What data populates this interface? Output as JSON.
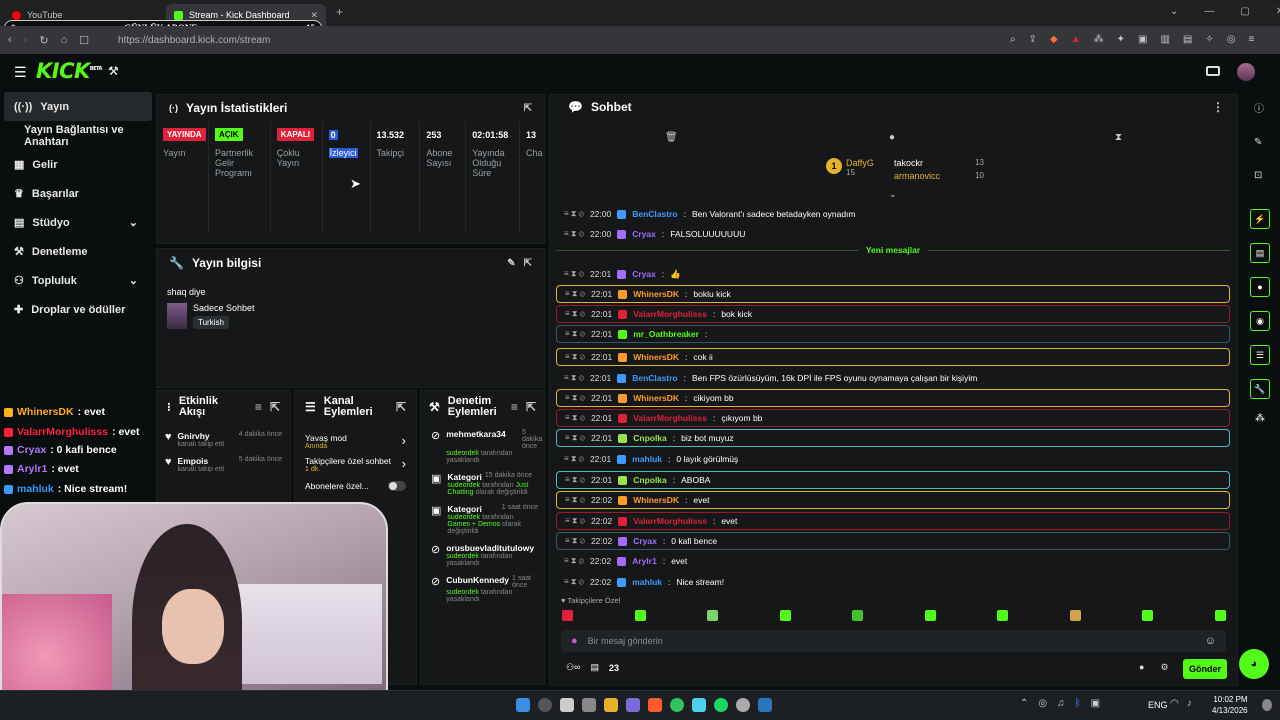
{
  "browser": {
    "tabs": [
      {
        "label": "YouTube"
      },
      {
        "label": "Stream - Kick Dashboard"
      }
    ],
    "overlay_title": "GÜNLÜK ABONE",
    "overlay_left": "0",
    "overlay_right": "15",
    "url": "https://dashboard.kick.com/stream"
  },
  "app": {
    "logo": "KICK",
    "logo_badge": "BETA"
  },
  "sidebar": {
    "items": [
      {
        "label": "Yayın",
        "icon": "broadcast-icon"
      },
      {
        "label": "Yayın Bağlantısı ve Anahtarı",
        "icon": "key-icon"
      },
      {
        "label": "Gelir",
        "icon": "revenue-icon"
      },
      {
        "label": "Başarılar",
        "icon": "trophy-icon"
      },
      {
        "label": "Stüdyo",
        "icon": "studio-icon"
      },
      {
        "label": "Denetleme",
        "icon": "hammer-icon"
      },
      {
        "label": "Topluluk",
        "icon": "community-icon"
      },
      {
        "label": "Droplar ve ödüller",
        "icon": "gift-icon"
      }
    ]
  },
  "stats": {
    "title": "Yayın İstatistikleri",
    "cols": [
      {
        "value": "YAYINDA",
        "label": "Yayın"
      },
      {
        "value": "AÇIK",
        "label": "Partnerlik Gelir Programı"
      },
      {
        "value": "KAPALI",
        "label": "Çoklu Yayın"
      },
      {
        "value": "0",
        "label": "İzleyici"
      },
      {
        "value": "13.532",
        "label": "Takipçi"
      },
      {
        "value": "253",
        "label": "Abone Sayısı"
      },
      {
        "value": "02:01:58",
        "label": "Yayında Olduğu Süre"
      },
      {
        "value": "13",
        "label": "Cha In A"
      }
    ]
  },
  "info": {
    "title": "Yayın bilgisi",
    "stream_title": "shaq diye",
    "category": "Sadece Sohbet",
    "tag": "Turkish"
  },
  "activity": {
    "title": "Etkinlik Akışı",
    "items": [
      {
        "name": "Gnirvhy",
        "time": "4 dakika önce",
        "desc": "kanalı takip etti"
      },
      {
        "name": "Empois",
        "time": "5 dakika önce",
        "desc": "kanalı takip etti"
      }
    ]
  },
  "channel": {
    "title": "Kanal Eylemleri",
    "items": [
      {
        "label": "Yavaş mod",
        "sub": "Anında"
      },
      {
        "label": "Takipçilere özel sohbet",
        "sub": "1 dk."
      },
      {
        "label": "Abonelere özel..."
      }
    ]
  },
  "moderation": {
    "title": "Denetim Eylemleri",
    "items": [
      {
        "name": "mehmetkara34",
        "time": "5 dakika önce",
        "l1": "sudeordek",
        "l2": "tarafından",
        "l3": "yasaklandı"
      },
      {
        "name": "Kategori",
        "time": "15 dakika önce",
        "l1": "sudeordek",
        "l2": "tarafından",
        "l3": "Just Chatting",
        "l4": "olarak değiştirildi"
      },
      {
        "name": "Kategori",
        "time": "1 saat önce",
        "l1": "sudeordek",
        "l2": "tarafından",
        "l3": "Games + Demos",
        "l4": "olarak değiştirildi"
      },
      {
        "name": "orusbuevladitutulowy",
        "l1": "sudeordek",
        "l2": "tarafından yasaklandı"
      },
      {
        "name": "CubunKennedy",
        "time": "1 saat önce",
        "l1": "sudeordek",
        "l2": "tarafından yasaklandı"
      }
    ]
  },
  "chat": {
    "title": "Sohbet",
    "leaderboard": [
      {
        "rank": "1",
        "name": "DaffyG",
        "count": "15"
      },
      {
        "name": "takockr",
        "count": "13"
      },
      {
        "name": "armanovicc",
        "count": "10"
      }
    ],
    "new_messages": "Yeni mesajlar",
    "messages": [
      {
        "time": "22:00",
        "user": "BenClastro",
        "ucolor": "#3b9cff",
        "text": "Ben Valorant'ı sadece betadayken oynadım",
        "hl": ""
      },
      {
        "time": "22:00",
        "user": "Cryax",
        "ucolor": "#a46bff",
        "text": "FALSOLUUUUUUU",
        "hl": ""
      },
      {
        "time": "22:01",
        "user": "Cryax",
        "ucolor": "#a46bff",
        "text": "👍",
        "hl": ""
      },
      {
        "time": "22:01",
        "user": "WhinersDK",
        "ucolor": "#ff9b2b",
        "text": "boklu kick",
        "hl": "#e4b32a"
      },
      {
        "time": "22:01",
        "user": "ValarrMorghulisss",
        "ucolor": "#e0213c",
        "text": "bok kick",
        "hl": "#9a1a2a"
      },
      {
        "time": "22:01",
        "user": "mr_Oathbreaker",
        "ucolor": "#53fc18",
        "text": "",
        "hl": "#2f5c68"
      },
      {
        "time": "22:01",
        "user": "WhinersDK",
        "ucolor": "#ff9b2b",
        "text": "cok ii",
        "hl": "#e4b32a"
      },
      {
        "time": "22:01",
        "user": "BenClastro",
        "ucolor": "#3b9cff",
        "text": "Ben FPS özürlüsüyüm, 16k DPİ ile FPS oyunu oynamaya çalışan bir kişiyim",
        "hl": ""
      },
      {
        "time": "22:01",
        "user": "WhinersDK",
        "ucolor": "#ff9b2b",
        "text": "cikiyom bb",
        "hl": "#e4b32a"
      },
      {
        "time": "22:01",
        "user": "ValarrMorghulisss",
        "ucolor": "#e0213c",
        "text": "çıkıyom bb",
        "hl": "#9a1a2a"
      },
      {
        "time": "22:01",
        "user": "Cnpolka",
        "ucolor": "#9be34a",
        "text": "biz bot muyuz",
        "hl": "#3fc0c0"
      },
      {
        "time": "22:01",
        "user": "mahluk",
        "ucolor": "#3b9cff",
        "text": "0 layık görülmüş",
        "hl": ""
      },
      {
        "time": "22:01",
        "user": "Cnpolka",
        "ucolor": "#9be34a",
        "text": "ABOBA",
        "hl": "#3fc0c0"
      },
      {
        "time": "22:02",
        "user": "WhinersDK",
        "ucolor": "#ff9b2b",
        "text": "evet",
        "hl": "#e4b32a"
      },
      {
        "time": "22:02",
        "user": "ValarrMorghulisss",
        "ucolor": "#e0213c",
        "text": "evet",
        "hl": "#9a1a2a"
      },
      {
        "time": "22:02",
        "user": "Cryax",
        "ucolor": "#a46bff",
        "text": "0 kafi bence",
        "hl": "#2f5c68"
      },
      {
        "time": "22:02",
        "user": "Arylr1",
        "ucolor": "#a46bff",
        "text": "evet",
        "hl": ""
      },
      {
        "time": "22:02",
        "user": "mahluk",
        "ucolor": "#3b9cff",
        "text": "Nice stream!",
        "hl": ""
      }
    ],
    "followers_only": "Takipçilere Özel",
    "placeholder": "Bir mesaj gönderin",
    "viewer_count": "23",
    "send": "Gönder"
  },
  "overlay_chat": [
    {
      "user": "WhinersDK",
      "color": "#ffb020",
      "text": ": evet"
    },
    {
      "user": "ValarrMorghulisss",
      "color": "#ff2040",
      "text": ": evet"
    },
    {
      "user": "Cryax",
      "color": "#b07bff",
      "text": ": 0 kafi bence"
    },
    {
      "user": "Arylr1",
      "color": "#b07bff",
      "text": ": evet"
    },
    {
      "user": "mahluk",
      "color": "#3b9cff",
      "text": ": Nice stream!"
    }
  ],
  "taskbar": {
    "lang": "ENG",
    "time": "10:02 PM",
    "date": "4/13/2026"
  },
  "colors": {
    "accent": "#53fc18",
    "live": "#e0213c"
  }
}
